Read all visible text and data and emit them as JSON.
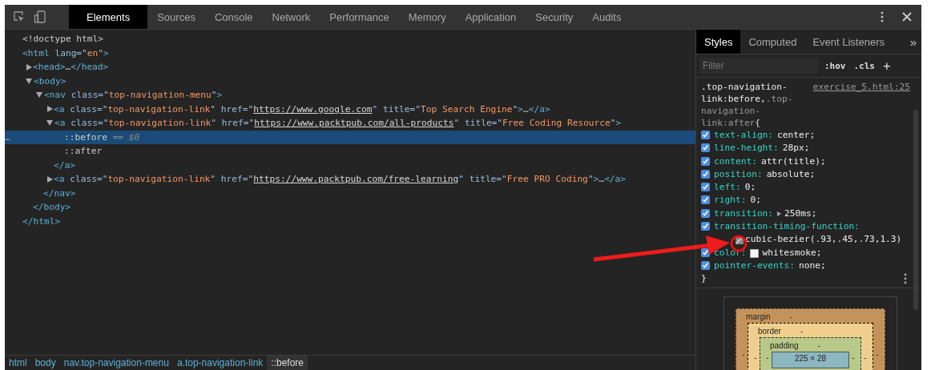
{
  "toolbar": {
    "tabs": [
      {
        "label": "Elements",
        "selected": true
      },
      {
        "label": "Sources",
        "selected": false
      },
      {
        "label": "Console",
        "selected": false
      },
      {
        "label": "Network",
        "selected": false
      },
      {
        "label": "Performance",
        "selected": false
      },
      {
        "label": "Memory",
        "selected": false
      },
      {
        "label": "Application",
        "selected": false
      },
      {
        "label": "Security",
        "selected": false
      },
      {
        "label": "Audits",
        "selected": false
      }
    ]
  },
  "dom_tree": [
    {
      "selected": false,
      "parts": [
        {
          "kind": "plain",
          "text": "<!doctype html>"
        }
      ]
    },
    {
      "selected": false,
      "parts": [
        {
          "kind": "tag",
          "text": "<html"
        },
        {
          "kind": "attr",
          "text": " lang=\""
        },
        {
          "kind": "value",
          "text": "en"
        },
        {
          "kind": "attr",
          "text": "\""
        },
        {
          "kind": "tag",
          "text": ">"
        }
      ],
      "closing": [
        {
          "kind": "tag",
          "text": "</html>"
        }
      ],
      "children": [
        {
          "selected": false,
          "expanded": false,
          "parts": [
            {
              "kind": "tag",
              "text": "<head>"
            },
            {
              "kind": "plain",
              "text": "…"
            },
            {
              "kind": "tag",
              "text": "</head>"
            }
          ]
        },
        {
          "selected": false,
          "expanded": true,
          "parts": [
            {
              "kind": "tag",
              "text": "<body>"
            }
          ],
          "closing": [
            {
              "kind": "tag",
              "text": "</body>"
            }
          ],
          "children": [
            {
              "selected": false,
              "expanded": true,
              "parts": [
                {
                  "kind": "tag",
                  "text": "<nav"
                },
                {
                  "kind": "attr",
                  "text": " class=\""
                },
                {
                  "kind": "value",
                  "text": "top-navigation-menu"
                },
                {
                  "kind": "attr",
                  "text": "\""
                },
                {
                  "kind": "tag",
                  "text": ">"
                }
              ],
              "closing": [
                {
                  "kind": "tag",
                  "text": "</nav>"
                }
              ],
              "children": [
                {
                  "selected": false,
                  "expanded": false,
                  "parts": [
                    {
                      "kind": "tag",
                      "text": "<a"
                    },
                    {
                      "kind": "attr",
                      "text": " class=\""
                    },
                    {
                      "kind": "value",
                      "text": "top-navigation-link"
                    },
                    {
                      "kind": "attr",
                      "text": "\" href=\""
                    },
                    {
                      "kind": "link",
                      "text": "https://www.google.com"
                    },
                    {
                      "kind": "attr",
                      "text": "\" title=\""
                    },
                    {
                      "kind": "value",
                      "text": "Top Search Engine"
                    },
                    {
                      "kind": "attr",
                      "text": "\""
                    },
                    {
                      "kind": "tag",
                      "text": ">"
                    },
                    {
                      "kind": "plain",
                      "text": "…"
                    },
                    {
                      "kind": "tag",
                      "text": "</a>"
                    }
                  ]
                },
                {
                  "selected": false,
                  "expanded": true,
                  "parts": [
                    {
                      "kind": "tag",
                      "text": "<a"
                    },
                    {
                      "kind": "attr",
                      "text": " class=\""
                    },
                    {
                      "kind": "value",
                      "text": "top-navigation-link"
                    },
                    {
                      "kind": "attr",
                      "text": "\" href=\""
                    },
                    {
                      "kind": "link",
                      "text": "https://www.packtpub.com/all-products"
                    },
                    {
                      "kind": "attr",
                      "text": "\" title=\""
                    },
                    {
                      "kind": "value",
                      "text": "Free Coding Resource"
                    },
                    {
                      "kind": "attr",
                      "text": "\""
                    },
                    {
                      "kind": "tag",
                      "text": ">"
                    }
                  ],
                  "closing": [
                    {
                      "kind": "tag",
                      "text": "</a>"
                    }
                  ],
                  "children": [
                    {
                      "selected": true,
                      "marker": "…",
                      "parts": [
                        {
                          "kind": "plain",
                          "text": "::before"
                        },
                        {
                          "kind": "hint",
                          "text": " == $0"
                        }
                      ]
                    },
                    {
                      "selected": false,
                      "parts": [
                        {
                          "kind": "plain",
                          "text": "::after"
                        }
                      ]
                    }
                  ]
                },
                {
                  "selected": false,
                  "expanded": false,
                  "parts": [
                    {
                      "kind": "tag",
                      "text": "<a"
                    },
                    {
                      "kind": "attr",
                      "text": " class=\""
                    },
                    {
                      "kind": "value",
                      "text": "top-navigation-link"
                    },
                    {
                      "kind": "attr",
                      "text": "\" href=\""
                    },
                    {
                      "kind": "link",
                      "text": "https://www.packtpub.com/free-learning"
                    },
                    {
                      "kind": "attr",
                      "text": "\" title=\""
                    },
                    {
                      "kind": "value",
                      "text": "Free PRO Coding"
                    },
                    {
                      "kind": "attr",
                      "text": "\""
                    },
                    {
                      "kind": "tag",
                      "text": ">"
                    },
                    {
                      "kind": "plain",
                      "text": "…"
                    },
                    {
                      "kind": "tag",
                      "text": "</a>"
                    }
                  ]
                }
              ]
            }
          ]
        }
      ]
    }
  ],
  "breadcrumbs": [
    {
      "label": "html",
      "selected": false
    },
    {
      "label": "body",
      "selected": false
    },
    {
      "label": "nav.top-navigation-menu",
      "selected": false
    },
    {
      "label": "a.top-navigation-link",
      "selected": false
    },
    {
      "label": "::before",
      "selected": true
    }
  ],
  "sidebar": {
    "tabs": [
      {
        "label": "Styles",
        "selected": true
      },
      {
        "label": "Computed",
        "selected": false
      },
      {
        "label": "Event Listeners",
        "selected": false
      }
    ],
    "more": "»",
    "filter": {
      "placeholder": "Filter"
    },
    "hov": ":hov",
    "cls": ".cls",
    "add": "+",
    "rule": {
      "selectors": [
        {
          "text": ".top-navigation-link:before,",
          "matched": true
        },
        {
          "text": ".top-navigation-link:after",
          "matched": false
        }
      ],
      "brace_open": "{",
      "source": "exercise_5.html:25",
      "brace_close": "}",
      "properties": [
        {
          "kind": "plain",
          "checked": true,
          "name": "text-align:",
          "value": "center;"
        },
        {
          "kind": "plain",
          "checked": true,
          "name": "line-height:",
          "value": "28px;"
        },
        {
          "kind": "plain",
          "checked": true,
          "name": "content:",
          "value": "attr(title);"
        },
        {
          "kind": "plain",
          "checked": true,
          "name": "position:",
          "value": "absolute;"
        },
        {
          "kind": "plain",
          "checked": true,
          "name": "left:",
          "value": "0;"
        },
        {
          "kind": "plain",
          "checked": true,
          "name": "right:",
          "value": "0;"
        },
        {
          "kind": "expandable",
          "checked": true,
          "name": "transition:",
          "value": "250ms;"
        },
        {
          "kind": "bezier",
          "checked": true,
          "name": "transition-timing-function:",
          "value": "cubic-bezier(.93,.45,.73,1.3)"
        },
        {
          "kind": "color",
          "checked": true,
          "name": "color:",
          "value": "whitesmoke;",
          "color": "#f5f5f5"
        },
        {
          "kind": "plain",
          "checked": true,
          "name": "pointer-events:",
          "value": "none;"
        }
      ]
    },
    "box_model": {
      "label": "margin",
      "top": "-",
      "left": "-",
      "inner": {
        "label": "border",
        "top": "-",
        "left": "-",
        "inner": {
          "label": "padding",
          "top": "-",
          "left": "-",
          "content": "225 × 28",
          "right": "-"
        },
        "right": "-"
      },
      "right": "-"
    }
  }
}
